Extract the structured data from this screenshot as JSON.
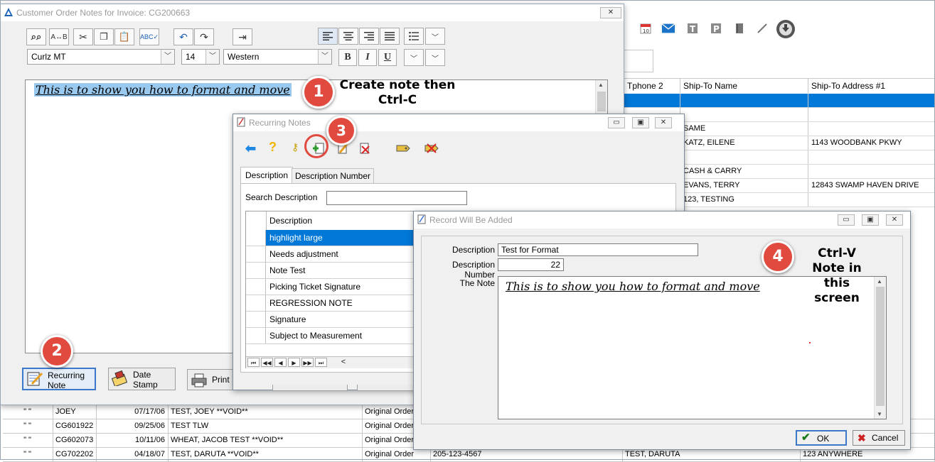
{
  "background": {
    "grid_headers": [
      "Tphone 2",
      "Ship-To Name",
      "Ship-To Address #1"
    ],
    "grid_rows": [
      {
        "name": "",
        "address": "",
        "selected": true
      },
      {
        "name": "",
        "address": ""
      },
      {
        "name": "SAME",
        "address": ""
      },
      {
        "name": "KATZ, EILENE",
        "address": "1143  WOODBANK PKWY"
      },
      {
        "name": "",
        "address": ""
      },
      {
        "name": "CASH & CARRY",
        "address": ""
      },
      {
        "name": "EVANS, TERRY",
        "address": "12843 SWAMP HAVEN DRIVE"
      },
      {
        "name": "123, TESTING",
        "address": ""
      }
    ],
    "bottom_rows": [
      {
        "c1": "\" \"",
        "c2": "JOEY",
        "c3": "07/17/06",
        "c4": "TEST, JOEY        **VOID**",
        "c5": "Original Order",
        "c6": "",
        "c7": "",
        "c8": ""
      },
      {
        "c1": "\" \"",
        "c2": "CG601922",
        "c3": "09/25/06",
        "c4": "TEST TLW",
        "c5": "Original Order",
        "c6": "",
        "c7": "",
        "c8": ""
      },
      {
        "c1": "\" \"",
        "c2": "CG602073",
        "c3": "10/11/06",
        "c4": "WHEAT, JACOB TEST     **VOID**",
        "c5": "Original Order",
        "c6": "",
        "c7": "",
        "c8": ""
      },
      {
        "c1": "\" \"",
        "c2": "CG702202",
        "c3": "04/18/07",
        "c4": "TEST, DARUTA        **VOID**",
        "c5": "Original Order",
        "c6": "205-123-4567",
        "c7": "TEST, DARUTA",
        "c8": "123 ANYWHERE"
      }
    ]
  },
  "notes_window": {
    "title": "Customer Order Notes for Invoice: CG200663",
    "close": "✕",
    "font_name": "Curlz MT",
    "font_size": "14",
    "script": "Western",
    "note_text": "This is to show you how to format and move",
    "buttons": {
      "recurring_note": "Recurring\nNote",
      "date_stamp": "Date\nStamp",
      "print": "Print"
    }
  },
  "recurring_window": {
    "title": "Recurring Notes",
    "tabs": [
      "Description",
      "Description Number"
    ],
    "search_label": "Search Description",
    "column_header": "Description",
    "items": [
      {
        "label": "highlight large",
        "selected": true
      },
      {
        "label": "Needs adjustment"
      },
      {
        "label": "Note Test"
      },
      {
        "label": "Picking Ticket Signature"
      },
      {
        "label": "REGRESSION NOTE"
      },
      {
        "label": "Signature"
      },
      {
        "label": "Subject to Measurement"
      }
    ],
    "nav": [
      "⏮",
      "◀◀",
      "◀",
      "▶",
      "▶▶",
      "⏭",
      "<"
    ]
  },
  "record_window": {
    "title": "Record Will Be Added",
    "description_label": "Description",
    "description_value": "Test for Format",
    "number_label": "Description Number",
    "number_value": "22",
    "note_label": "The Note",
    "note_text": "This is to show you how to format and move",
    "ok": "OK",
    "cancel": "Cancel"
  },
  "callouts": {
    "step1_number": "1",
    "step1_text": "Create note then\nCtrl-C",
    "step2_number": "2",
    "step3_number": "3",
    "step4_number": "4",
    "step4_text": "Ctrl-V\nNote in\nthis\nscreen"
  },
  "colors": {
    "selection": "#0078d7",
    "badge": "#e14a3f",
    "highlight_text_bg": "#99c9ef"
  }
}
